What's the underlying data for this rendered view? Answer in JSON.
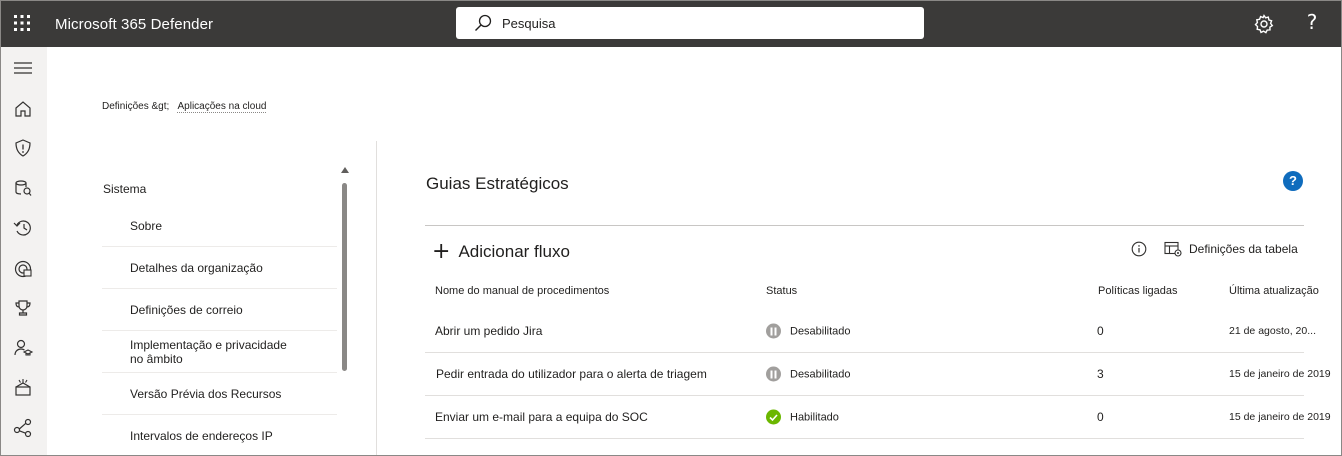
{
  "app": {
    "title": "Microsoft 365 Defender"
  },
  "search": {
    "placeholder": "Pesquisa"
  },
  "breadcrumb": {
    "root": "Definições &gt;",
    "current": "Aplicações na cloud"
  },
  "nav": {
    "heading": "Sistema",
    "items": [
      {
        "label": "Sobre"
      },
      {
        "label": "Detalhes da organização"
      },
      {
        "label": "Definições de correio"
      },
      {
        "label": "Implementação e privacidade no âmbito"
      },
      {
        "label": "Versão Prévia dos Recursos"
      },
      {
        "label": "Intervalos de endereços IP"
      }
    ]
  },
  "main": {
    "title": "Guias Estratégicos",
    "help": "?",
    "add_flow": "Adicionar fluxo",
    "table_settings": "Definições da tabela"
  },
  "table": {
    "columns": [
      "Nome do manual de procedimentos",
      "Status",
      "Políticas ligadas",
      "Última atualização"
    ],
    "rows": [
      {
        "name": "Abrir um pedido Jira",
        "status": "Desabilitado",
        "policies": "0",
        "updated": "21 de agosto, 20..."
      },
      {
        "name": "Pedir entrada do utilizador para o alerta de triagem",
        "status": "Desabilitado",
        "policies": "3",
        "updated": "15 de janeiro de 2019"
      },
      {
        "name": "Enviar um e-mail para a equipa do SOC",
        "status": "Habilitado",
        "policies": "0",
        "updated": "15 de janeiro de 2019"
      }
    ]
  },
  "colors": {
    "topbar": "#3b3a39",
    "rail": "#f3f2f1",
    "accent": "#0f6cbd",
    "enabled": "#6bb700",
    "disabled": "#a19f9d"
  },
  "icons": {
    "rail": [
      "menu-icon",
      "home-icon",
      "shield-icon",
      "asset-icon",
      "history-icon",
      "threat-analytics-icon",
      "trophy-icon",
      "learning-icon",
      "partner-icon",
      "connections-icon"
    ]
  }
}
